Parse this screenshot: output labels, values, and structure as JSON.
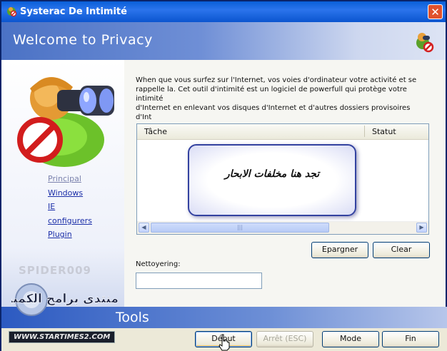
{
  "window": {
    "title": "Systerac De Intimité",
    "close_symbol": "✕"
  },
  "banner": {
    "title": "Welcome to Privacy",
    "icon": "privacy-spy-icon"
  },
  "nav": {
    "items": [
      {
        "label": "Principal",
        "active": true
      },
      {
        "label": "Windows",
        "active": false
      },
      {
        "label": "IE",
        "active": false
      },
      {
        "label": "configurers",
        "active": false
      },
      {
        "label": "Plugin",
        "active": false
      }
    ]
  },
  "description": "When que vous surfez sur l'Internet, vos voies d'ordinateur votre activité et se\nrappelle la. Cet outil d'intimité est un logiciel de powerfull qui protège votre intimité\nd'Internet en enlevant vos disques d'Internet et d'autres dossiers provisoires d'Int",
  "task_list": {
    "columns": [
      "Tâche",
      "Statut"
    ],
    "rows": []
  },
  "callout": {
    "text": "تجد هنا مخلفات الابحار"
  },
  "buttons": {
    "epargner": "Epargner",
    "clear": "Clear",
    "debut": "Début",
    "arret": "Arrêt (ESC)",
    "mode": "Mode",
    "fin": "Fin"
  },
  "nettoyering": {
    "label": "Nettoyering:",
    "value": ""
  },
  "watermarks": {
    "spider": "SPIDER009",
    "forum_arabic": "منتدى برامج الكمبيوتر",
    "site_url": "WWW.STARTIMES2.COM"
  },
  "tools_label": "Tools",
  "colors": {
    "titlebar": "#0a5fd8",
    "banner": "#4b72c5",
    "link": "#1b2ea8",
    "callout_border": "#3342a0"
  }
}
